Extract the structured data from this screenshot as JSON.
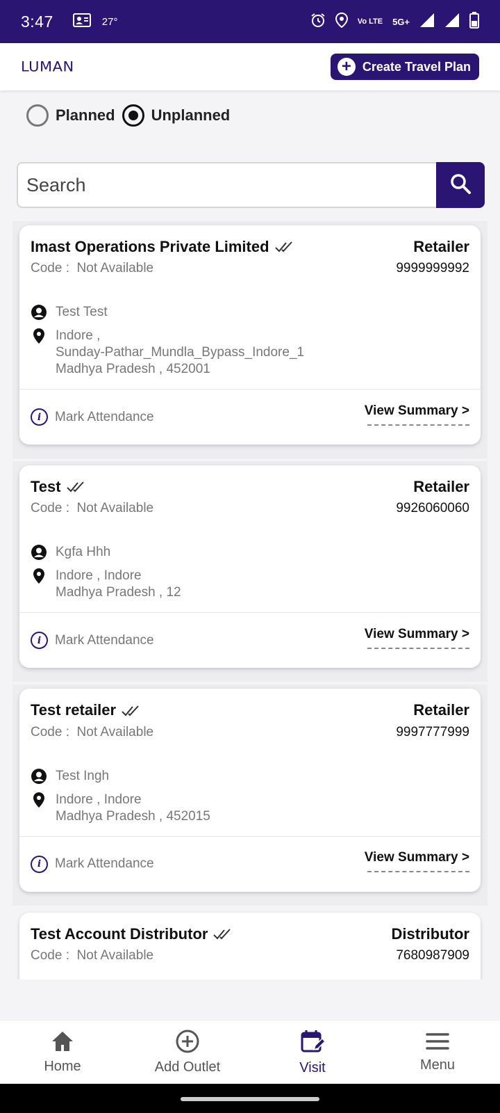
{
  "status_bar": {
    "time": "3:47",
    "temperature": "27°",
    "network": "Vo LTE",
    "network_5g": "5G+"
  },
  "app_bar": {
    "logo": "LUMAN",
    "create_button": "Create Travel Plan"
  },
  "filter": {
    "options": [
      "Planned",
      "Unplanned"
    ],
    "selected": "Unplanned"
  },
  "search": {
    "placeholder": "Search"
  },
  "outlets": [
    {
      "name": "Imast Operations Private Limited",
      "type": "Retailer",
      "code_label": "Code :",
      "code_value": "Not Available",
      "phone": "9999999992",
      "contact": "Test Test",
      "address_lines": [
        "Indore ,",
        "Sunday-Pathar_Mundla_Bypass_Indore_1",
        "Madhya Pradesh , 452001"
      ],
      "action": "Mark Attendance",
      "summary": "View Summary >"
    },
    {
      "name": "Test",
      "type": "Retailer",
      "code_label": "Code :",
      "code_value": "Not Available",
      "phone": "9926060060",
      "contact": "Kgfa Hhh",
      "address_lines": [
        "Indore , Indore",
        "Madhya Pradesh , 12"
      ],
      "action": "Mark Attendance",
      "summary": "View Summary >"
    },
    {
      "name": "Test retailer",
      "type": "Retailer",
      "code_label": "Code :",
      "code_value": "Not Available",
      "phone": "9997777999",
      "contact": "Test Ingh",
      "address_lines": [
        "Indore , Indore",
        "Madhya Pradesh , 452015"
      ],
      "action": "Mark Attendance",
      "summary": "View Summary >"
    },
    {
      "name": "Test Account Distributor",
      "type": "Distributor",
      "code_label": "Code :",
      "code_value": "Not Available",
      "phone": "7680987909"
    }
  ],
  "bottom_nav": [
    {
      "label": "Home",
      "icon": "home-icon"
    },
    {
      "label": "Add Outlet",
      "icon": "add-circle-icon"
    },
    {
      "label": "Visit",
      "icon": "calendar-edit-icon",
      "active": true
    },
    {
      "label": "Menu",
      "icon": "menu-icon"
    }
  ],
  "colors": {
    "brand": "#2b1573",
    "muted_text": "#777777"
  }
}
